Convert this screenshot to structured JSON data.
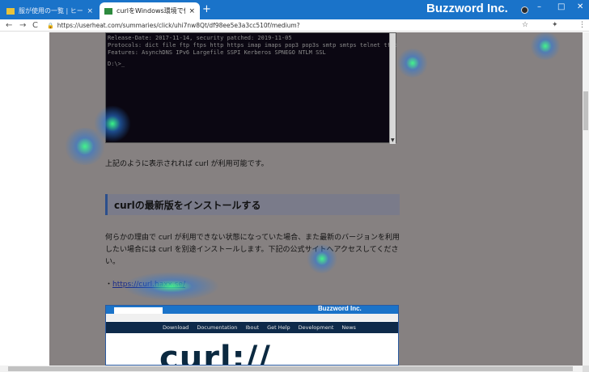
{
  "browser": {
    "tabs": [
      {
        "label": "服が使用の一覧 | ヒートマップ解析",
        "favicon_color": "#e8c33a"
      },
      {
        "label": "curlをWindows環境で使用する | ",
        "favicon_color": "#2d8a3e"
      }
    ],
    "new_tab": "+",
    "brand": "Buzzword Inc.",
    "url": "https://userheat.com/summaries/click/uhi7nw8Qt/df98ee5e3a3cc510f/medium?",
    "tab_close": "×",
    "nav": {
      "back": "←",
      "forward": "→",
      "reload": "C"
    },
    "window_controls": {
      "minimize": "–",
      "maximize": "□",
      "close": "✕"
    },
    "toolbar_icons": {
      "star": "☆",
      "extensions": "✦",
      "menu": "⋮"
    }
  },
  "terminal": {
    "lines": [
      "Release-Date: 2017-11-14, security patched: 2019-11-05",
      "Protocols: dict file ftp ftps http https imap imaps pop3 pop3s smtp smtps telnet tftp",
      "Features: AsynchDNS IPv6 Largefile SSPI Kerberos SPNEGO NTLM SSL",
      "",
      "D:\\>_"
    ]
  },
  "article": {
    "para1": "上記のように表示されれば curl が利用可能です。",
    "heading": "curlの最新版をインストールする",
    "para2": "何らかの理由で curl が利用できない状態になっていた場合、また最新のバージョンを利用したい場合には curl を別途インストールします。下記の公式サイトへアクセスしてください。",
    "link_bullet": "・",
    "link": "https://curl.haxx.se/"
  },
  "embedded_screenshot": {
    "brand": "Buzzword Inc.",
    "nav": [
      "Download",
      "Documentation",
      "Ibout",
      "Get Help",
      "Development",
      "News"
    ],
    "logo": "curl://"
  },
  "colors": {
    "chrome": "#1a73c9",
    "overlay": "#868181",
    "heading_accent": "#2c4f8c",
    "heat_glow": "#3cff8c"
  }
}
